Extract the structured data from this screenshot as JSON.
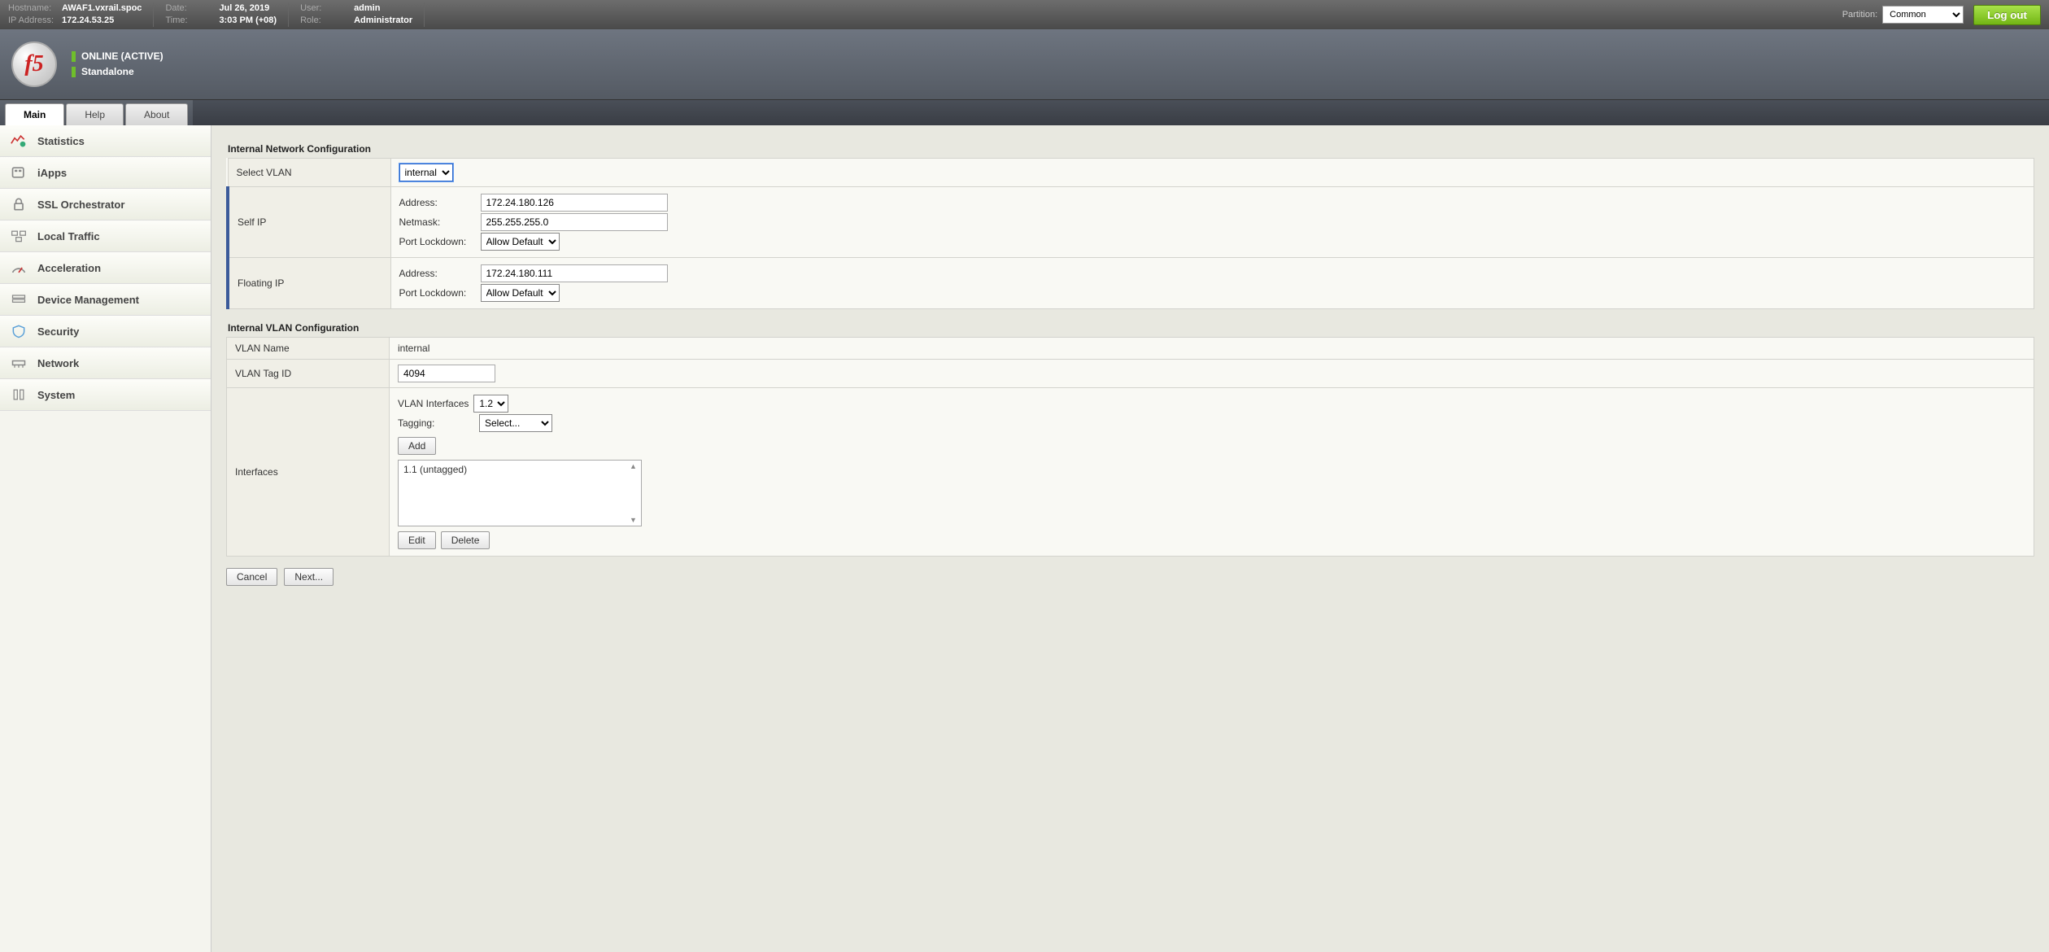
{
  "topbar": {
    "hostname_lbl": "Hostname:",
    "hostname": "AWAF1.vxrail.spoc",
    "ip_lbl": "IP Address:",
    "ip": "172.24.53.25",
    "date_lbl": "Date:",
    "date": "Jul 26, 2019",
    "time_lbl": "Time:",
    "time": "3:03 PM (+08)",
    "user_lbl": "User:",
    "user": "admin",
    "role_lbl": "Role:",
    "role": "Administrator",
    "partition_lbl": "Partition:",
    "partition_value": "Common",
    "logout": "Log out"
  },
  "status": {
    "line1": "ONLINE (ACTIVE)",
    "line2": "Standalone",
    "logo_text": "f5"
  },
  "tabs": {
    "main": "Main",
    "help": "Help",
    "about": "About"
  },
  "sidebar": {
    "items": [
      {
        "label": "Statistics"
      },
      {
        "label": "iApps"
      },
      {
        "label": "SSL Orchestrator"
      },
      {
        "label": "Local Traffic"
      },
      {
        "label": "Acceleration"
      },
      {
        "label": "Device Management"
      },
      {
        "label": "Security"
      },
      {
        "label": "Network"
      },
      {
        "label": "System"
      }
    ]
  },
  "net": {
    "title": "Internal Network Configuration",
    "select_vlan_lbl": "Select VLAN",
    "select_vlan_value": "internal",
    "self_ip_lbl": "Self IP",
    "self_ip": {
      "address_lbl": "Address:",
      "address": "172.24.180.126",
      "netmask_lbl": "Netmask:",
      "netmask": "255.255.255.0",
      "port_lockdown_lbl": "Port Lockdown:",
      "port_lockdown": "Allow Default"
    },
    "float_ip_lbl": "Floating IP",
    "float_ip": {
      "address_lbl": "Address:",
      "address": "172.24.180.111",
      "port_lockdown_lbl": "Port Lockdown:",
      "port_lockdown": "Allow Default"
    }
  },
  "vlan": {
    "title": "Internal VLAN Configuration",
    "name_lbl": "VLAN Name",
    "name": "internal",
    "tagid_lbl": "VLAN Tag ID",
    "tagid": "4094",
    "interfaces_lbl": "Interfaces",
    "vlan_ifaces_lbl": "VLAN Interfaces",
    "vlan_iface_value": "1.2",
    "tagging_lbl": "Tagging:",
    "tagging_value": "Select...",
    "add_btn": "Add",
    "list_entry": "1.1 (untagged)",
    "edit_btn": "Edit",
    "delete_btn": "Delete"
  },
  "footer": {
    "cancel": "Cancel",
    "next": "Next..."
  }
}
